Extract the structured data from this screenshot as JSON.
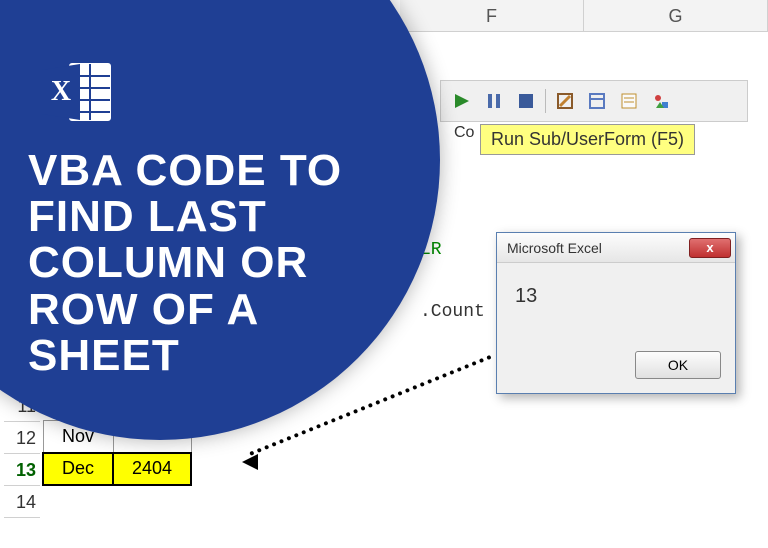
{
  "title": {
    "line1": "VBA CODE TO",
    "line2": "FIND LAST",
    "line3": "COLUMN OR",
    "line4": "ROW OF A",
    "line5": "SHEET"
  },
  "columns": [
    "F",
    "G"
  ],
  "toolbar": {
    "tooltip_prefix": "Co",
    "tooltip": "Run Sub/UserForm (F5)"
  },
  "code": {
    "var": "LR",
    "line2": ".Count"
  },
  "rows": [
    {
      "num": "11"
    },
    {
      "num": "12",
      "month": "Nov",
      "value": ""
    },
    {
      "num": "13",
      "month": "Dec",
      "value": "2404",
      "highlight": true
    },
    {
      "num": "14"
    }
  ],
  "msgbox": {
    "title": "Microsoft Excel",
    "close": "x",
    "body": "13",
    "ok": "OK"
  }
}
